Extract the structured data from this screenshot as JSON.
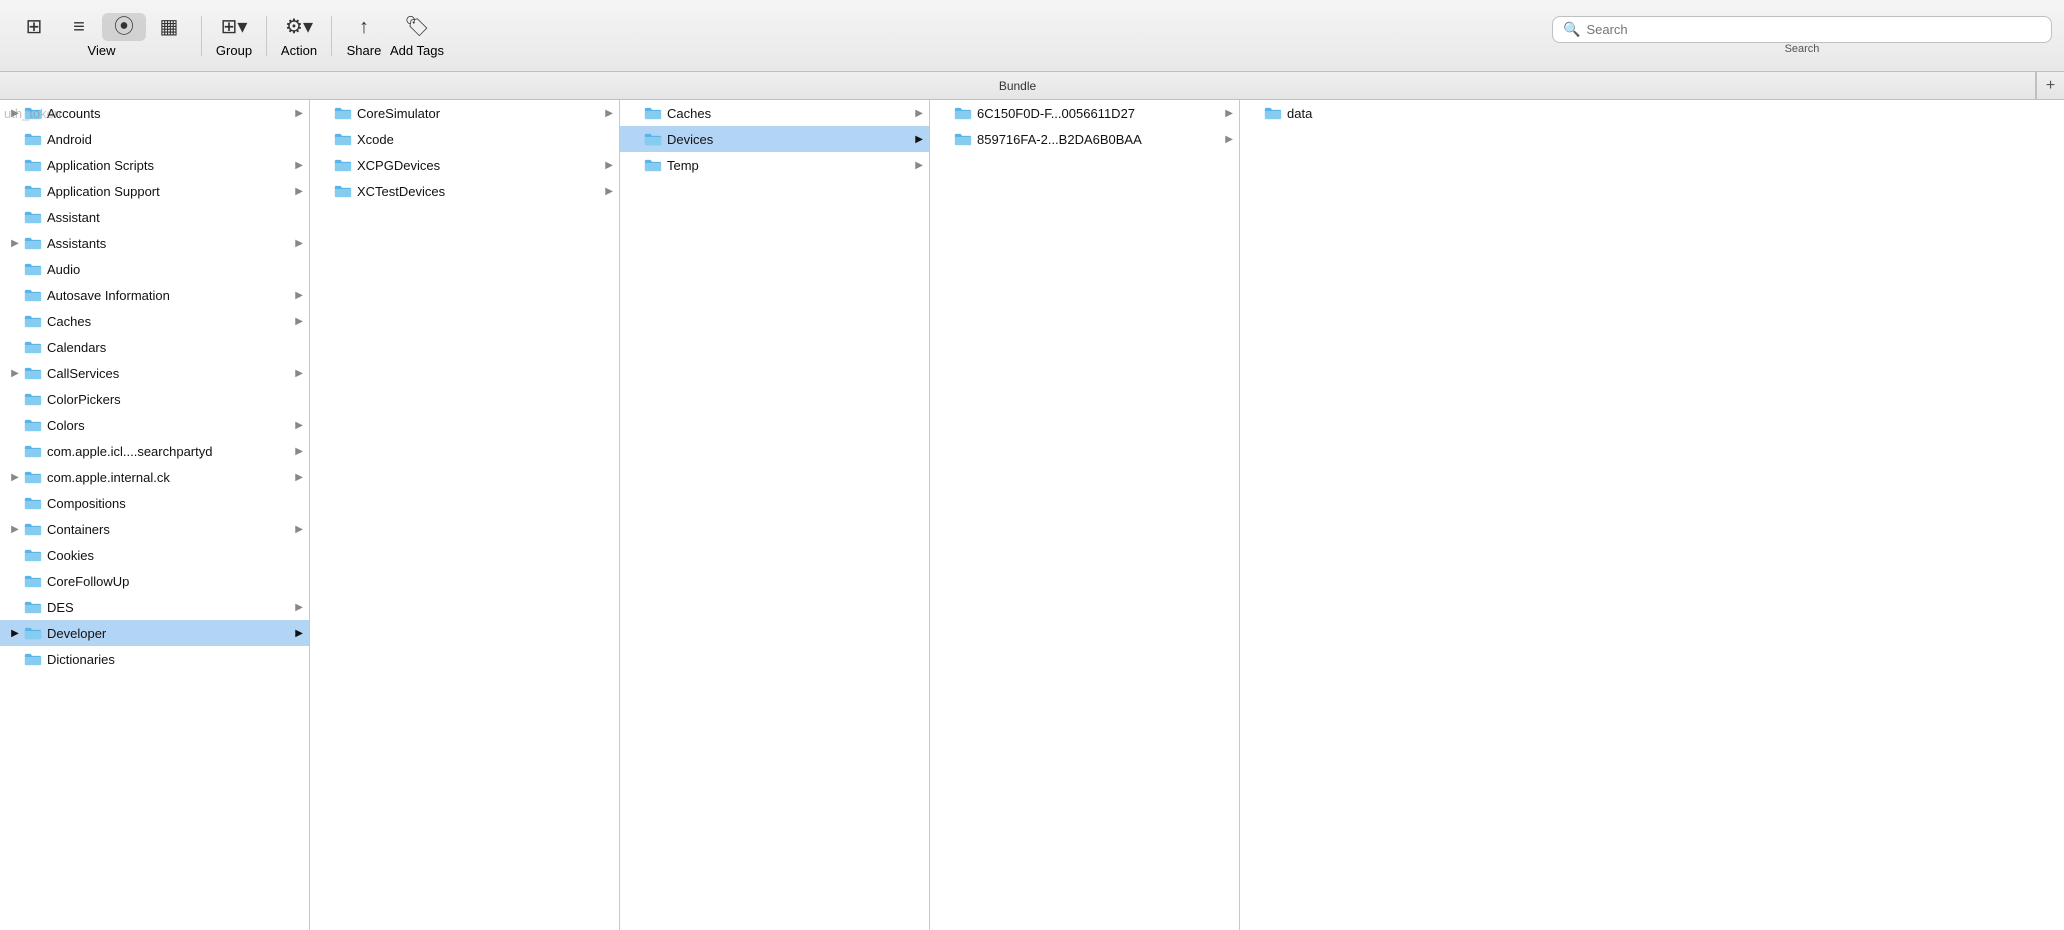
{
  "toolbar": {
    "view_label": "View",
    "group_label": "Group",
    "action_label": "Action",
    "share_label": "Share",
    "add_tags_label": "Add Tags",
    "search_label": "Search",
    "search_placeholder": "Search"
  },
  "columns": {
    "header": "Bundle",
    "add_btn": "+"
  },
  "col1_items": [
    {
      "name": "Accounts",
      "has_arrow": true,
      "has_expand": true,
      "selected": false
    },
    {
      "name": "Android",
      "has_arrow": false,
      "has_expand": false,
      "selected": false
    },
    {
      "name": "Application Scripts",
      "has_arrow": true,
      "has_expand": false,
      "selected": false
    },
    {
      "name": "Application Support",
      "has_arrow": true,
      "has_expand": false,
      "selected": false
    },
    {
      "name": "Assistant",
      "has_arrow": false,
      "has_expand": false,
      "selected": false
    },
    {
      "name": "Assistants",
      "has_arrow": true,
      "has_expand": true,
      "selected": false
    },
    {
      "name": "Audio",
      "has_arrow": false,
      "has_expand": false,
      "selected": false
    },
    {
      "name": "Autosave Information",
      "has_arrow": true,
      "has_expand": false,
      "selected": false
    },
    {
      "name": "Caches",
      "has_arrow": true,
      "has_expand": false,
      "selected": false
    },
    {
      "name": "Calendars",
      "has_arrow": false,
      "has_expand": false,
      "selected": false
    },
    {
      "name": "CallServices",
      "has_arrow": true,
      "has_expand": true,
      "selected": false
    },
    {
      "name": "ColorPickers",
      "has_arrow": false,
      "has_expand": false,
      "selected": false
    },
    {
      "name": "Colors",
      "has_arrow": true,
      "has_expand": false,
      "selected": false
    },
    {
      "name": "com.apple.icl....searchpartyd",
      "has_arrow": true,
      "has_expand": false,
      "selected": false
    },
    {
      "name": "com.apple.internal.ck",
      "has_arrow": true,
      "has_expand": true,
      "selected": false
    },
    {
      "name": "Compositions",
      "has_arrow": false,
      "has_expand": false,
      "selected": false
    },
    {
      "name": "Containers",
      "has_arrow": true,
      "has_expand": true,
      "selected": false
    },
    {
      "name": "Cookies",
      "has_arrow": false,
      "has_expand": false,
      "selected": false
    },
    {
      "name": "CoreFollowUp",
      "has_arrow": false,
      "has_expand": false,
      "selected": false
    },
    {
      "name": "DES",
      "has_arrow": true,
      "has_expand": false,
      "selected": false
    },
    {
      "name": "Developer",
      "has_arrow": true,
      "has_expand": true,
      "selected": true
    },
    {
      "name": "Dictionaries",
      "has_arrow": false,
      "has_expand": false,
      "selected": false
    }
  ],
  "col2_items": [
    {
      "name": "CoreSimulator",
      "has_arrow": true,
      "has_expand": false,
      "selected": false
    },
    {
      "name": "Xcode",
      "has_arrow": false,
      "has_expand": false,
      "selected": false
    },
    {
      "name": "XCPGDevices",
      "has_arrow": true,
      "has_expand": false,
      "selected": false
    },
    {
      "name": "XCTestDevices",
      "has_arrow": true,
      "has_expand": false,
      "selected": false
    }
  ],
  "col3_items": [
    {
      "name": "Caches",
      "has_arrow": true,
      "has_expand": false,
      "selected": false
    },
    {
      "name": "Devices",
      "has_arrow": true,
      "has_expand": false,
      "selected": true
    },
    {
      "name": "Temp",
      "has_arrow": true,
      "has_expand": false,
      "selected": false
    }
  ],
  "col4_items": [
    {
      "name": "6C150F0D-F...0056611D27",
      "has_arrow": true,
      "has_expand": false,
      "selected": false
    },
    {
      "name": "859716FA-2...B2DA6B0BAA",
      "has_arrow": true,
      "has_expand": false,
      "selected": false
    }
  ],
  "col5_items": [
    {
      "name": "data",
      "has_arrow": false,
      "has_expand": false,
      "selected": false
    }
  ],
  "partial_text": "uth_token"
}
